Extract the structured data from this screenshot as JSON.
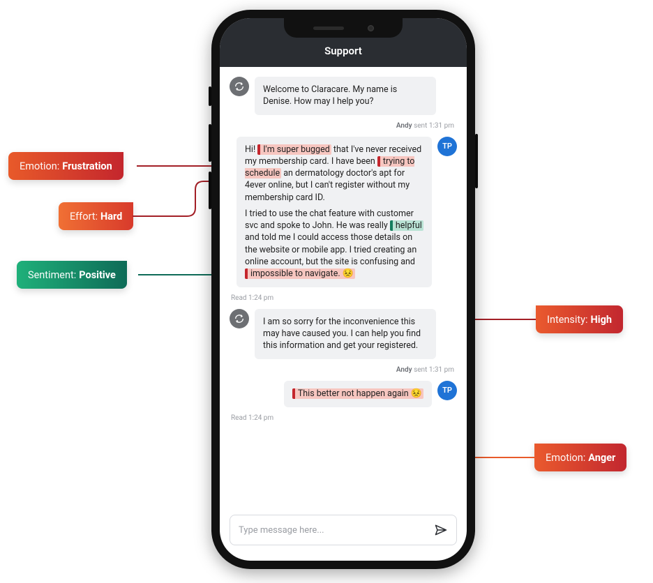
{
  "header": {
    "title": "Support"
  },
  "input": {
    "placeholder": "Type message here..."
  },
  "messages": {
    "m1": {
      "text": "Welcome to Claracare. My name is Denise. How may I help you?",
      "meta_name": "Andy",
      "meta_status": "sent",
      "meta_time": "1:31 pm",
      "avatar": "agent"
    },
    "m2": {
      "avatar_label": "TP",
      "read_label": "Read",
      "read_time": "1:24 pm",
      "t_pre": "Hi! ",
      "t_h1": "I'm super bugged",
      "t_mid1": " that I've never received my membership card. I have been ",
      "t_h2": "trying to schedule",
      "t_mid2": " an dermatology doctor's apt for 4ever online, but I can't register without my membership card ID.",
      "t_p2a": "I tried to use the chat feature with customer svc and spoke to John. He was really ",
      "t_h3": "helpful",
      "t_p2b": " and told me I could access those details on the website or mobile app. I tried creating an online account,  but the site is confusing and ",
      "t_h4": "impossible to navigate.",
      "t_emoji": "😣"
    },
    "m3": {
      "text": "I am so sorry for the inconvenience this may have caused you. I can help you find this information and get your registered.",
      "meta_name": "Andy",
      "meta_status": "sent",
      "meta_time": "1:31 pm"
    },
    "m4": {
      "avatar_label": "TP",
      "text": "This better not happen again ",
      "emoji": "😣",
      "read_label": "Read",
      "read_time": "1:24 pm"
    }
  },
  "tags": {
    "emotion_frustration": {
      "label": "Emotion:",
      "value": "Frustration"
    },
    "effort_hard": {
      "label": "Effort:",
      "value": "Hard"
    },
    "sentiment_positive": {
      "label": "Sentiment:",
      "value": "Positive"
    },
    "intensity_high": {
      "label": "Intensity:",
      "value": "High"
    },
    "emotion_anger": {
      "label": "Emotion:",
      "value": "Anger"
    }
  }
}
